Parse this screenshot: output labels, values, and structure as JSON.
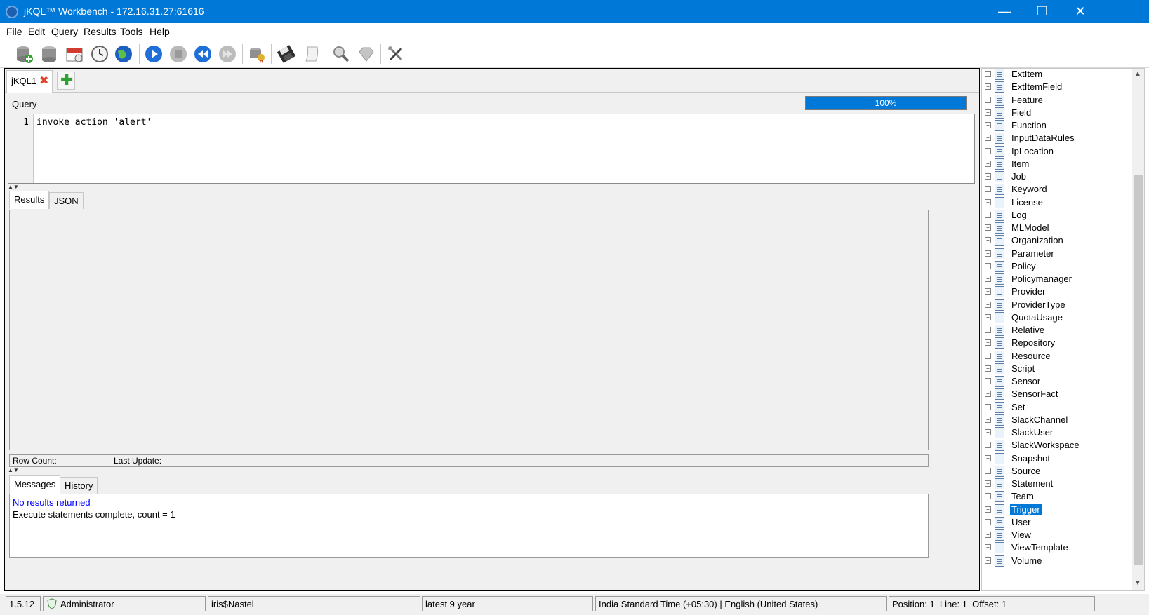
{
  "window": {
    "title": "jKQL™ Workbench - 172.16.31.27:61616",
    "controls": {
      "minimize": "—",
      "restore": "❐",
      "close": "✕"
    }
  },
  "menu": [
    "File",
    "Edit",
    "Query",
    "Results",
    "Tools",
    "Help"
  ],
  "toolbar": {
    "icons": [
      "connect-icon",
      "database-icon",
      "calendar-icon",
      "clock-icon",
      "globe-icon",
      "run-icon",
      "stop-icon",
      "rewind-icon",
      "fast-forward-icon",
      "certificate-icon",
      "save-icon",
      "script-icon",
      "search-icon",
      "diamond-icon",
      "tools-icon"
    ]
  },
  "tabs": {
    "doc_tab": "jKQL1",
    "close_glyph": "✖",
    "add_glyph": "✚"
  },
  "query": {
    "label": "Query",
    "progress_text": "100%",
    "progress_value": 100,
    "line_number": "1",
    "code": "invoke action 'alert'"
  },
  "results": {
    "tabs": [
      "Results",
      "JSON"
    ],
    "row_count_label": "Row Count:",
    "last_update_label": "Last Update:"
  },
  "messages": {
    "tabs": [
      "Messages",
      "History"
    ],
    "line1": "No results returned",
    "line2": "Execute statements complete, count = 1"
  },
  "tree": {
    "items": [
      "ExtItem",
      "ExtItemField",
      "Feature",
      "Field",
      "Function",
      "InputDataRules",
      "IpLocation",
      "Item",
      "Job",
      "Keyword",
      "License",
      "Log",
      "MLModel",
      "Organization",
      "Parameter",
      "Policy",
      "Policymanager",
      "Provider",
      "ProviderType",
      "QuotaUsage",
      "Relative",
      "Repository",
      "Resource",
      "Script",
      "Sensor",
      "SensorFact",
      "Set",
      "SlackChannel",
      "SlackUser",
      "SlackWorkspace",
      "Snapshot",
      "Source",
      "Statement",
      "Team",
      "Trigger",
      "User",
      "View",
      "ViewTemplate",
      "Volume"
    ],
    "selected": "Trigger"
  },
  "status": {
    "version": "1.5.12",
    "user": "Administrator",
    "repo": "iris$Nastel",
    "range": "latest 9 year",
    "locale": "India Standard Time (+05:30) | English (United States)",
    "position": "Position: 1  Line: 1  Offset: 1"
  },
  "colors": {
    "accent": "#0078d7",
    "message_blue": "#0000ff",
    "close_red": "#e0422c",
    "add_green": "#2ea12e"
  }
}
